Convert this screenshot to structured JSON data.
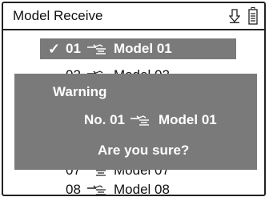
{
  "title": "Model Receive",
  "icons": {
    "download": "download-arrow-icon",
    "battery": "battery-icon",
    "link": "model-link-icon",
    "check": "checkmark-icon"
  },
  "colors": {
    "highlight": "#7a7a7a",
    "border": "#222222",
    "text": "#111111",
    "inverse_text": "#ffffff"
  },
  "list": {
    "items": [
      {
        "number": "01",
        "name": "Model  01",
        "selected": true,
        "check": "✓"
      },
      {
        "number": "02",
        "name": "Model  02"
      },
      {
        "number": "07",
        "name": "Model  07"
      },
      {
        "number": "08",
        "name": "Model  08"
      }
    ]
  },
  "dialog": {
    "title": "Warning",
    "model_number": "No. 01",
    "model_name": "Model  01",
    "question": "Are you sure?"
  }
}
